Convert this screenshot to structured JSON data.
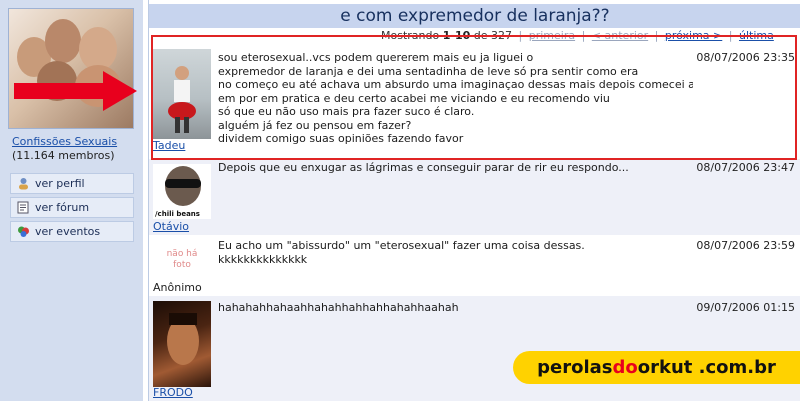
{
  "sidebar": {
    "community_name": "Confissões Sexuais",
    "members": "(11.164 membros)",
    "menu": [
      {
        "label": "ver perfil",
        "icon": "user-icon"
      },
      {
        "label": "ver fórum",
        "icon": "forum-icon"
      },
      {
        "label": "ver eventos",
        "icon": "events-icon"
      }
    ]
  },
  "topic": {
    "title": "e com expremedor de laranja??"
  },
  "pager": {
    "showing_label": "Mostrando",
    "range": "1-10",
    "of_label": "de",
    "total": "327",
    "first": "primeira",
    "previous": "< anterior",
    "next": "próxima >",
    "last": "última"
  },
  "posts": [
    {
      "author": "Tadeu",
      "date": "08/07/2006 23:35",
      "lines": [
        "sou eterosexual..vcs podem quererem mais eu ja liguei o",
        "expremedor de laranja e dei uma sentadinha de leve só pra sentir como era",
        "no começo eu até achava um absurdo uma imaginaçao dessas mais depois comecei a pensar",
        "em por em pratica e deu certo acabei me viciando e eu recomendo viu",
        "só que eu não uso mais pra fazer suco é claro.",
        "alguém já fez ou pensou em fazer?",
        "dividem comigo suas opiniões fazendo favor"
      ]
    },
    {
      "author": "Otávio",
      "date": "08/07/2006 23:47",
      "lines": [
        "Depois que eu enxugar as lágrimas e conseguir parar de rir eu respondo..."
      ],
      "avatar_caption": "/chili beans"
    },
    {
      "author": "Anônimo",
      "date": "08/07/2006 23:59",
      "lines": [
        "Eu acho um \"abissurdo\" um \"eterosexual\" fazer uma coisa dessas.",
        "kkkkkkkkkkkkkk"
      ],
      "avatar_caption": "não há foto"
    },
    {
      "author": "FRODO",
      "date": "09/07/2006 01:15",
      "lines": [
        "hahahahhahaahhahahhahhahhahahhaahah"
      ]
    }
  ],
  "watermark": {
    "part1": "perolas ",
    "part2": "do",
    "part3": " orkut .com.br"
  },
  "colors": {
    "sidebar_bg": "#d3ddef",
    "title_bar_bg": "#c7d4ee",
    "link": "#1a4fa8",
    "highlight_border": "#e02424",
    "arrow": "#e8001d",
    "watermark_bg": "#ffd200"
  }
}
